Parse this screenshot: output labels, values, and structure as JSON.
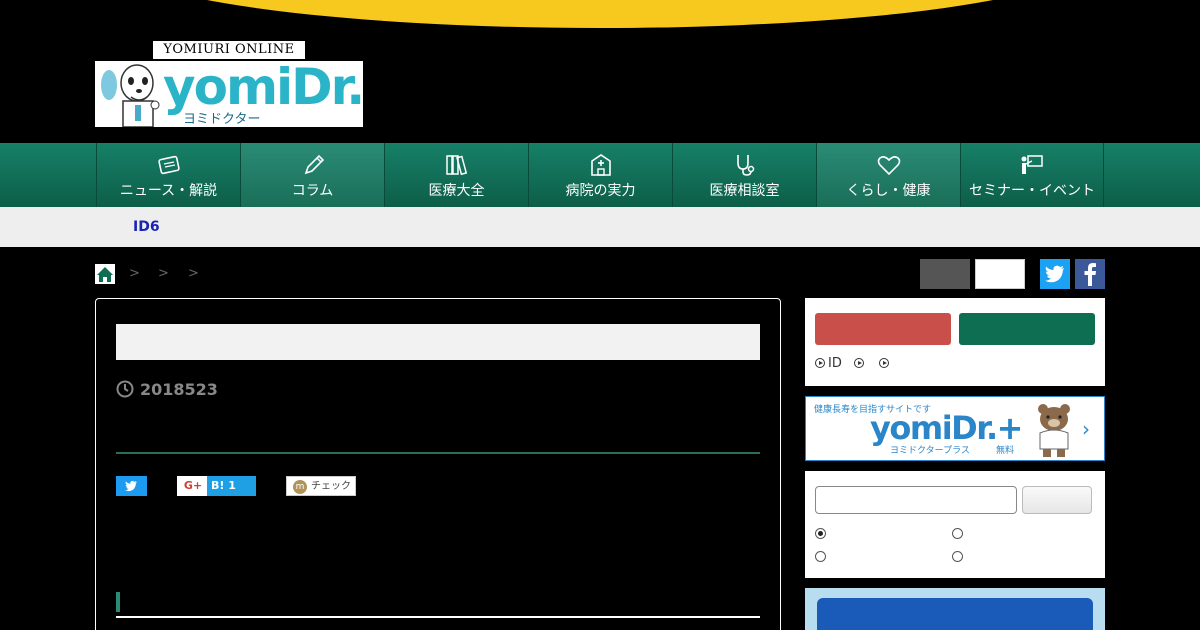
{
  "header": {
    "brand_top": "YOMIURI ONLINE",
    "logo_text": "yomiDr.",
    "logo_kana": "ヨミドクター"
  },
  "nav": {
    "items": [
      {
        "label": "ニュース・解説",
        "icon": "newspaper-icon"
      },
      {
        "label": "コラム",
        "icon": "pencil-icon",
        "active": true
      },
      {
        "label": "医療大全",
        "icon": "books-icon"
      },
      {
        "label": "病院の実力",
        "icon": "hospital-icon"
      },
      {
        "label": "医療相談室",
        "icon": "stethoscope-icon"
      },
      {
        "label": "くらし・健康",
        "icon": "heart-icon",
        "active": true
      },
      {
        "label": "セミナー・イベント",
        "icon": "seminar-icon"
      }
    ]
  },
  "subbar": {
    "label": "ID6"
  },
  "breadcrumb": {
    "separators": [
      ">",
      ">",
      ">"
    ]
  },
  "article": {
    "date": "2018523"
  },
  "share": {
    "google_label": "G+",
    "hatena_label": "B! 1",
    "mixi_label": "チェック",
    "mixi_mark": "m"
  },
  "login": {
    "links": [
      "ID",
      "",
      ""
    ]
  },
  "banner": {
    "tagline": "健康長寿を目指すサイトです",
    "brand": "yomiDr.+",
    "kana": "ヨミドクタープラス",
    "free": "無料",
    "chevron": "›"
  },
  "colors": {
    "nav_green": "#178068",
    "accent_yellow": "#f7c81e",
    "subbar_link": "#1a24b4",
    "twitter": "#1da1f2",
    "facebook": "#3b5998",
    "login_red": "#c9504a",
    "login_green": "#0d6e52"
  }
}
